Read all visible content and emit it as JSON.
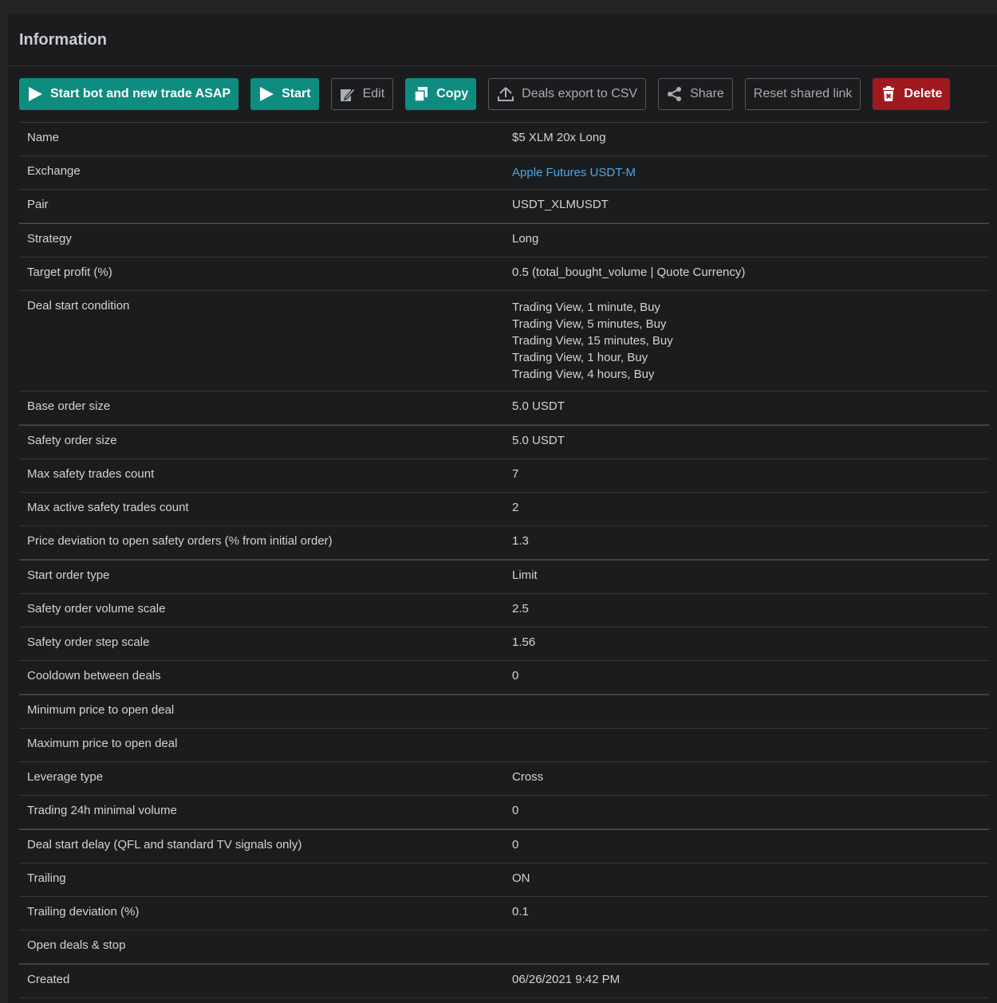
{
  "header": {
    "title": "Information"
  },
  "toolbar": {
    "start_asap": "Start bot and new trade ASAP",
    "start": "Start",
    "edit": "Edit",
    "copy": "Copy",
    "export": "Deals export to CSV",
    "share": "Share",
    "reset_link": "Reset shared link",
    "delete": "Delete"
  },
  "colors": {
    "teal": "#0f8c80",
    "red": "#a0191f",
    "link": "#4ea6e0",
    "panel": "#1b1c1e"
  },
  "rows": [
    {
      "key": "Name",
      "value": "$5 XLM 20x Long"
    },
    {
      "key": "Exchange",
      "value": "Apple Futures USDT-M"
    },
    {
      "key": "Pair",
      "value": "USDT_XLMUSDT"
    },
    {
      "key": "Strategy",
      "value": "Long"
    },
    {
      "key": "Target profit (%)",
      "value": "0.5 (total_bought_volume | Quote Currency)"
    },
    {
      "key": "Deal start condition",
      "lines": [
        "Trading View, 1 minute, Buy",
        "Trading View, 5 minutes, Buy",
        "Trading View, 15 minutes, Buy",
        "Trading View, 1 hour, Buy",
        "Trading View, 4 hours, Buy"
      ]
    },
    {
      "key": "Base order size",
      "value": "5.0 USDT"
    },
    {
      "key": "Safety order size",
      "value": "5.0 USDT"
    },
    {
      "key": "Max safety trades count",
      "value": "7"
    },
    {
      "key": "Max active safety trades count",
      "value": "2"
    },
    {
      "key": "Price deviation to open safety orders (% from initial order)",
      "value": "1.3"
    },
    {
      "key": "Start order type",
      "value": "Limit"
    },
    {
      "key": "Safety order volume scale",
      "value": "2.5"
    },
    {
      "key": "Safety order step scale",
      "value": "1.56"
    },
    {
      "key": "Cooldown between deals",
      "value": "0"
    },
    {
      "key": "Minimum price to open deal",
      "value": ""
    },
    {
      "key": "Maximum price to open deal",
      "value": ""
    },
    {
      "key": "Leverage type",
      "value": "Cross"
    },
    {
      "key": "Trading 24h minimal volume",
      "value": "0"
    },
    {
      "key": "Deal start delay (QFL and standard TV signals only)",
      "value": "0"
    },
    {
      "key": "Trailing",
      "value": "ON"
    },
    {
      "key": "Trailing deviation (%)",
      "value": "0.1"
    },
    {
      "key": "Open deals & stop",
      "value": ""
    },
    {
      "key": "Created",
      "value": "06/26/2021 9:42 PM"
    }
  ]
}
